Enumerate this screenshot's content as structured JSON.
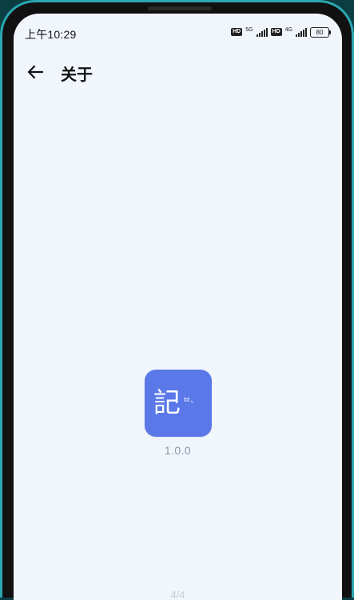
{
  "status_bar": {
    "time": "上午10:29",
    "hd1": "HD",
    "net1": "5G",
    "hd2": "HD",
    "net2": "4G",
    "battery": "80"
  },
  "app_bar": {
    "title": "关于"
  },
  "about": {
    "logo_main": "記",
    "logo_sub": "ㅂ、",
    "version": "1.0.0"
  },
  "page_indicator": "4/4",
  "colors": {
    "accent": "#5a78e8",
    "background": "#f1f6fd",
    "frame": "#2aa7b0"
  }
}
